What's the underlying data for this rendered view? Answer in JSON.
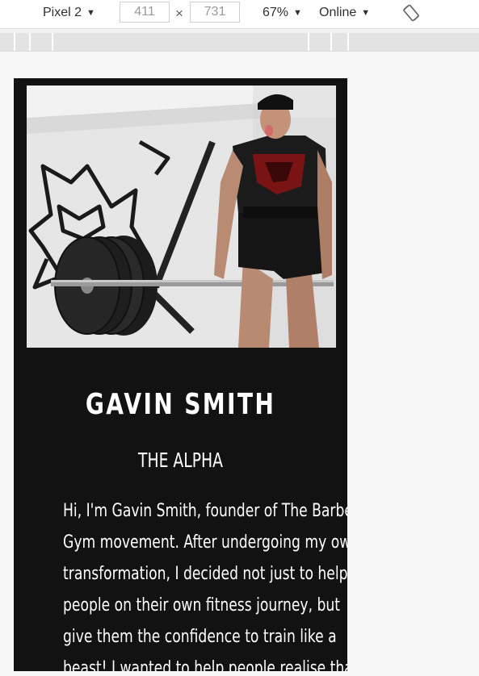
{
  "devtools": {
    "device": "Pixel 2",
    "width": "411",
    "height": "731",
    "dimension_separator": "×",
    "zoom": "67%",
    "network": "Online",
    "rotate_icon": "rotate-device-icon",
    "caret_icon": "▼"
  },
  "profile": {
    "image_alt": "Athlete deadlifting a loaded barbell in front of a wall mural",
    "name": "GAVIN SMITH",
    "role": "THE ALPHA",
    "bio_lines": [
      "Hi, I'm Gavin Smith, founder of The Barbell",
      "Gym movement. After undergoing my own",
      "transformation, I decided not just to help",
      "people on their own fitness journey, but",
      "give them the confidence to train like a",
      "beast! I wanted to help people realise that"
    ]
  },
  "colors": {
    "card_background": "#121212",
    "text": "#ffffff",
    "page_background": "#f7f7f7"
  }
}
